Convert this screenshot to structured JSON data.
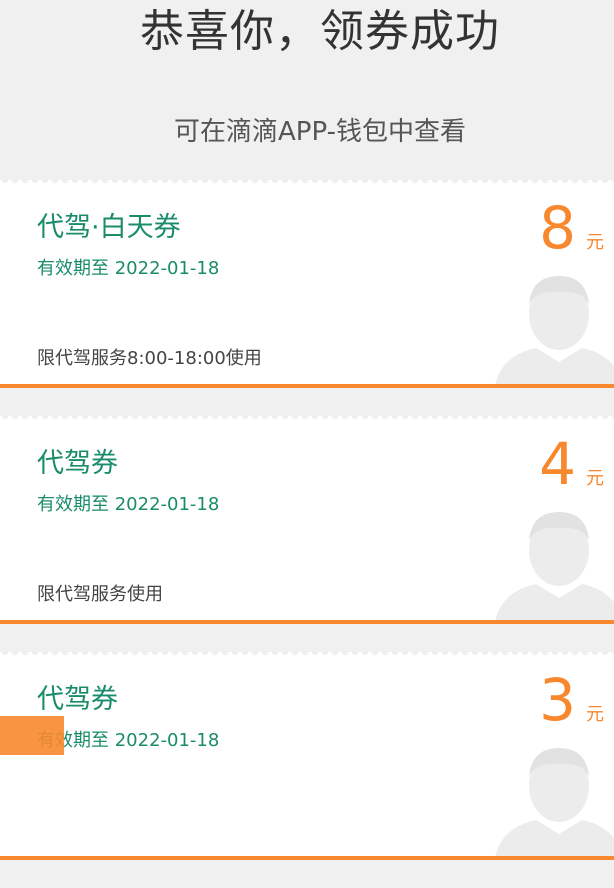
{
  "header": {
    "title": "恭喜你，领券成功",
    "subtitle": "可在滴滴APP-钱包中查看"
  },
  "coupons": [
    {
      "title": "代驾·白天券",
      "expiry": "有效期至 2022-01-18",
      "limit": "限代驾服务8:00-18:00使用",
      "amount": "8",
      "unit": "元"
    },
    {
      "title": "代驾券",
      "expiry": "有效期至 2022-01-18",
      "limit": "限代驾服务使用",
      "amount": "4",
      "unit": "元"
    },
    {
      "title": "代驾券",
      "expiry": "有效期至 2022-01-18",
      "limit": "",
      "amount": "3",
      "unit": "元"
    }
  ],
  "colors": {
    "accent": "#f7882e",
    "coupon_text": "#1a8c6a",
    "background": "#f0f0f0"
  },
  "icons": {
    "watermark": "driver-avatar-icon"
  }
}
